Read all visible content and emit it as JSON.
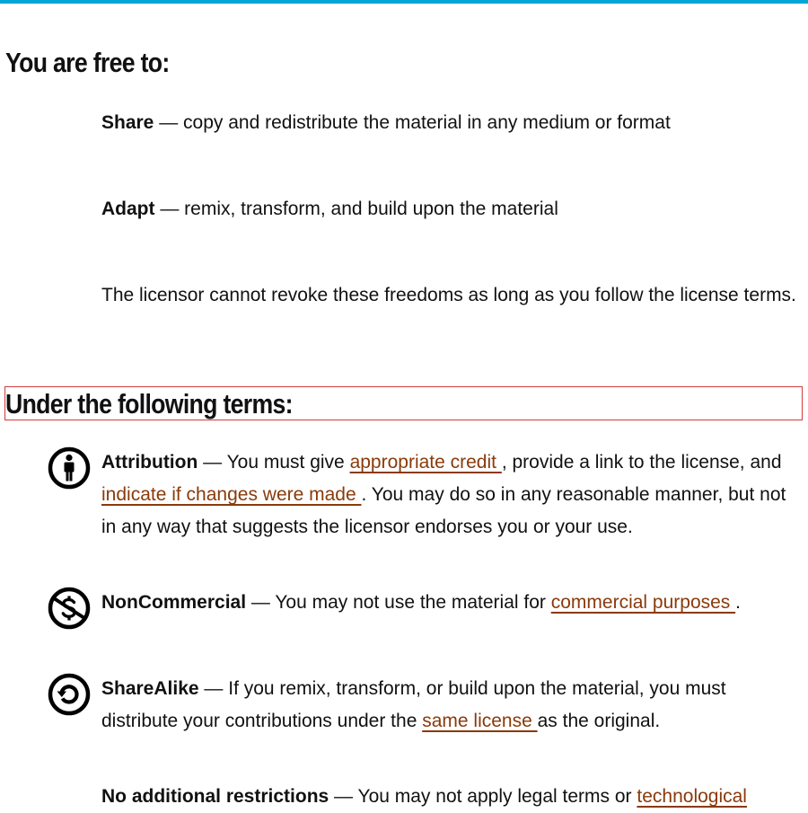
{
  "free_section": {
    "heading": "You are free to:",
    "share": {
      "term": "Share",
      "text": " — copy and redistribute the material in any medium or format"
    },
    "adapt": {
      "term": "Adapt",
      "text": " — remix, transform, and build upon the material"
    },
    "revoke_text": "The licensor cannot revoke these freedoms as long as you follow the license terms."
  },
  "terms_section": {
    "heading": "Under the following terms:",
    "attribution": {
      "icon": "attribution-icon",
      "term": "Attribution",
      "text_1": " — You must give ",
      "link_1": "appropriate credit ",
      "text_2": ", provide a link to the license, and ",
      "link_2": "indicate if changes were made ",
      "text_3": ". You may do so in any reasonable manner, but not in any way that suggests the licensor endorses you or your use."
    },
    "noncommercial": {
      "icon": "noncommercial-icon",
      "term": "NonCommercial",
      "text_1": " — You may not use the material for ",
      "link_1": "commercial purposes ",
      "text_2": "."
    },
    "sharealike": {
      "icon": "sharealike-icon",
      "term": "ShareAlike",
      "text_1": " — If you remix, transform, or build upon the material, you must distribute your contributions under the ",
      "link_1": "same license ",
      "text_2": "as the original."
    },
    "no_additional": {
      "term": "No additional restrictions",
      "text_1": " — You may not apply legal terms or ",
      "link_1": "technological"
    }
  },
  "colors": {
    "accent_bar": "#04a6d6",
    "link": "#8a3a0a",
    "heading_outline": "#d33a3a",
    "text": "#111111"
  }
}
